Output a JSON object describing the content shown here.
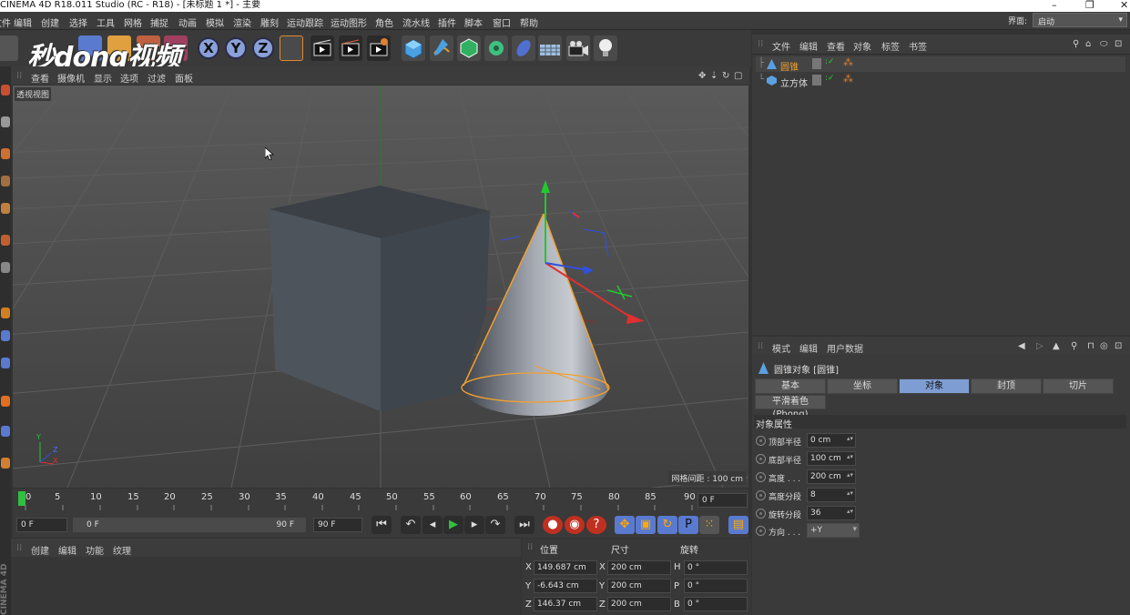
{
  "window": {
    "title": "CINEMA 4D R18.011 Studio (RC - R18) - [未标题 1 *] - 主要",
    "minimize": "–",
    "maximize": "❐",
    "close": "✕"
  },
  "menubar": {
    "items": [
      "文件",
      "编辑",
      "创建",
      "选择",
      "工具",
      "网格",
      "捕捉",
      "动画",
      "模拟",
      "渲染",
      "雕刻",
      "运动跟踪",
      "运动图形",
      "角色",
      "流水线",
      "插件",
      "脚本",
      "窗口",
      "帮助"
    ],
    "layout_label": "界面:",
    "layout_value": "启动"
  },
  "watermark": "秒dong视频",
  "toolbar": {
    "axis": [
      "X",
      "Y",
      "Z"
    ]
  },
  "viewport": {
    "menu": [
      "查看",
      "摄像机",
      "显示",
      "选项",
      "过滤",
      "面板"
    ],
    "label": "透视视图",
    "grid_info": "网格间距 : 100 cm",
    "axes": [
      "Y",
      "Z",
      "X"
    ]
  },
  "timeline": {
    "ticks": [
      "0",
      "5",
      "10",
      "15",
      "20",
      "25",
      "30",
      "35",
      "40",
      "45",
      "50",
      "55",
      "60",
      "65",
      "70",
      "75",
      "80",
      "85",
      "90"
    ],
    "current_frame": "0 F"
  },
  "transport": {
    "start": "0 F",
    "range_start": "0 F",
    "range_end": "90 F",
    "end": "90 F"
  },
  "material": {
    "menu": [
      "创建",
      "编辑",
      "功能",
      "纹理"
    ]
  },
  "coords": {
    "headers": [
      "位置",
      "尺寸",
      "旋转"
    ],
    "rows": [
      {
        "axis": "X",
        "pos": "149.687 cm",
        "size_axis": "X",
        "size": "200 cm",
        "rot_axis": "H",
        "rot": "0 °"
      },
      {
        "axis": "Y",
        "pos": "-6.643 cm",
        "size_axis": "Y",
        "size": "200 cm",
        "rot_axis": "P",
        "rot": "0 °"
      },
      {
        "axis": "Z",
        "pos": "146.37 cm",
        "size_axis": "Z",
        "size": "200 cm",
        "rot_axis": "B",
        "rot": "0 °"
      }
    ]
  },
  "objects": {
    "menu": [
      "文件",
      "编辑",
      "查看",
      "对象",
      "标签",
      "书签"
    ],
    "items": [
      {
        "name": "圆锥",
        "selected": true
      },
      {
        "name": "立方体",
        "selected": false
      }
    ]
  },
  "attributes": {
    "menu": [
      "模式",
      "编辑",
      "用户数据"
    ],
    "title": "圆锥对象 [圆锥]",
    "tabs": [
      "基本",
      "坐标",
      "对象",
      "封顶",
      "切片"
    ],
    "active_tab": "对象",
    "phong": "平滑着色(Phong)",
    "section": "对象属性",
    "props": [
      {
        "label": "顶部半径",
        "value": "0 cm"
      },
      {
        "label": "底部半径",
        "value": "100 cm"
      },
      {
        "label": "高度 . . .",
        "value": "200 cm"
      },
      {
        "label": "高度分段",
        "value": "8"
      },
      {
        "label": "旋转分段",
        "value": "36"
      },
      {
        "label": "方向 . . .",
        "value": "+Y"
      }
    ]
  },
  "side_version": "CINEMA 4D",
  "colors": {
    "accent": "#7e9ed3",
    "viewport": "#4b4b4b",
    "panel": "#3a3a3a",
    "selection": "#f0a030"
  }
}
